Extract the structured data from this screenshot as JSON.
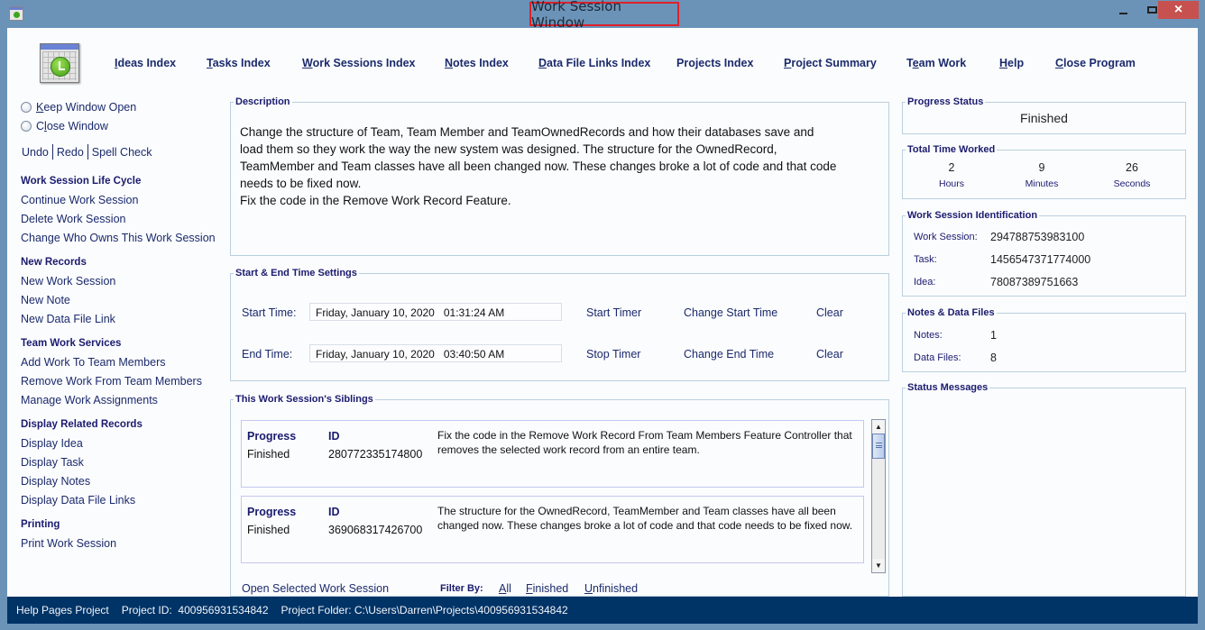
{
  "window": {
    "title": "Work Session Window",
    "controls": {
      "minimize": "minimize",
      "maximize": "maximize",
      "close": "×"
    }
  },
  "topnav": {
    "items": [
      {
        "label": "Ideas Index",
        "mnemonic": "I"
      },
      {
        "label": "Tasks Index",
        "mnemonic": "T"
      },
      {
        "label": "Work Sessions Index",
        "mnemonic": "W"
      },
      {
        "label": "Notes Index",
        "mnemonic": "N"
      },
      {
        "label": "Data File Links Index",
        "mnemonic": "D"
      },
      {
        "label": "Projects Index",
        "mnemonic": ""
      },
      {
        "label": "Project Summary",
        "mnemonic": "P"
      },
      {
        "label": "Team Work",
        "mnemonic": "e"
      },
      {
        "label": "Help",
        "mnemonic": "H"
      },
      {
        "label": "Close Program",
        "mnemonic": "C"
      }
    ]
  },
  "sidebar": {
    "radios": [
      {
        "label": "Keep Window Open",
        "checked": false
      },
      {
        "label": "Close Window",
        "checked": false
      }
    ],
    "edit": {
      "undo": "Undo",
      "redo": "Redo",
      "spell": "Spell Check"
    },
    "groups": [
      {
        "title": "Work Session Life Cycle",
        "items": [
          "Continue Work Session",
          "Delete Work Session",
          "Change Who Owns This Work Session"
        ]
      },
      {
        "title": "New Records",
        "items": [
          "New Work Session",
          "New Note",
          "New Data File Link"
        ]
      },
      {
        "title": "Team Work Services",
        "items": [
          "Add Work To Team Members",
          "Remove Work From Team Members",
          "Manage Work Assignments"
        ]
      },
      {
        "title": "Display Related Records",
        "items": [
          "Display Idea",
          "Display Task",
          "Display Notes",
          "Display Data File Links"
        ]
      },
      {
        "title": "Printing",
        "items": [
          "Print Work Session"
        ]
      }
    ]
  },
  "description": {
    "legend": "Description",
    "text": "Change the structure of Team, Team Member and TeamOwnedRecords and how their databases save and\nload them so they work the way the new system was designed. The structure for the OwnedRecord,\nTeamMember and Team classes have all been changed now. These changes broke a lot of code and that code\nneeds to be fixed now.\nFix the code in the Remove Work Record Feature."
  },
  "times": {
    "legend": "Start & End Time Settings",
    "start": {
      "label": "Start Time:",
      "value": "Friday, January 10, 2020   01:31:24 AM",
      "timer": "Start Timer",
      "change": "Change Start Time",
      "clear": "Clear"
    },
    "end": {
      "label": "End Time:",
      "value": "Friday, January 10, 2020   03:40:50 AM",
      "timer": "Stop Timer",
      "change": "Change End Time",
      "clear": "Clear"
    }
  },
  "siblings": {
    "legend": "This Work Session's Siblings",
    "progress_header": "Progress",
    "id_header": "ID",
    "items": [
      {
        "progress": "Finished",
        "id": "280772335174800",
        "description": "Fix the code in the Remove Work Record From Team Members Feature Controller that removes the selected work record from an entire team."
      },
      {
        "progress": "Finished",
        "id": "369068317426700",
        "description": "The structure for the OwnedRecord, TeamMember and Team classes have all been changed now. These changes broke a lot of code and that code needs to be fixed now."
      }
    ],
    "open_selected": "Open Selected Work Session",
    "filter_label": "Filter By:",
    "filters": [
      "All",
      "Finished",
      "Unfinished"
    ]
  },
  "progress_status": {
    "legend": "Progress Status",
    "value": "Finished"
  },
  "total_time": {
    "legend": "Total Time Worked",
    "hours": "2",
    "hours_label": "Hours",
    "minutes": "9",
    "minutes_label": "Minutes",
    "seconds": "26",
    "seconds_label": "Seconds"
  },
  "identification": {
    "legend": "Work Session Identification",
    "work_session_label": "Work Session:",
    "work_session": "294788753983100",
    "task_label": "Task:",
    "task": "1456547371774000",
    "idea_label": "Idea:",
    "idea": "78087389751663"
  },
  "notes_files": {
    "legend": "Notes & Data Files",
    "notes_label": "Notes:",
    "notes": "1",
    "files_label": "Data Files:",
    "files": "8"
  },
  "status_messages": {
    "legend": "Status Messages"
  },
  "statusbar": {
    "project_name": "Help Pages Project",
    "project_id": "Project ID:  400956931534842",
    "project_folder": "Project Folder: C:\\Users\\Darren\\Projects\\400956931534842"
  },
  "colors": {
    "titlebar": "#6b93b8",
    "statusbar": "#003366",
    "link": "#1b2a6b",
    "heading": "#1b1b6e",
    "close": "#c7514e",
    "highlight": "#e0202a"
  }
}
